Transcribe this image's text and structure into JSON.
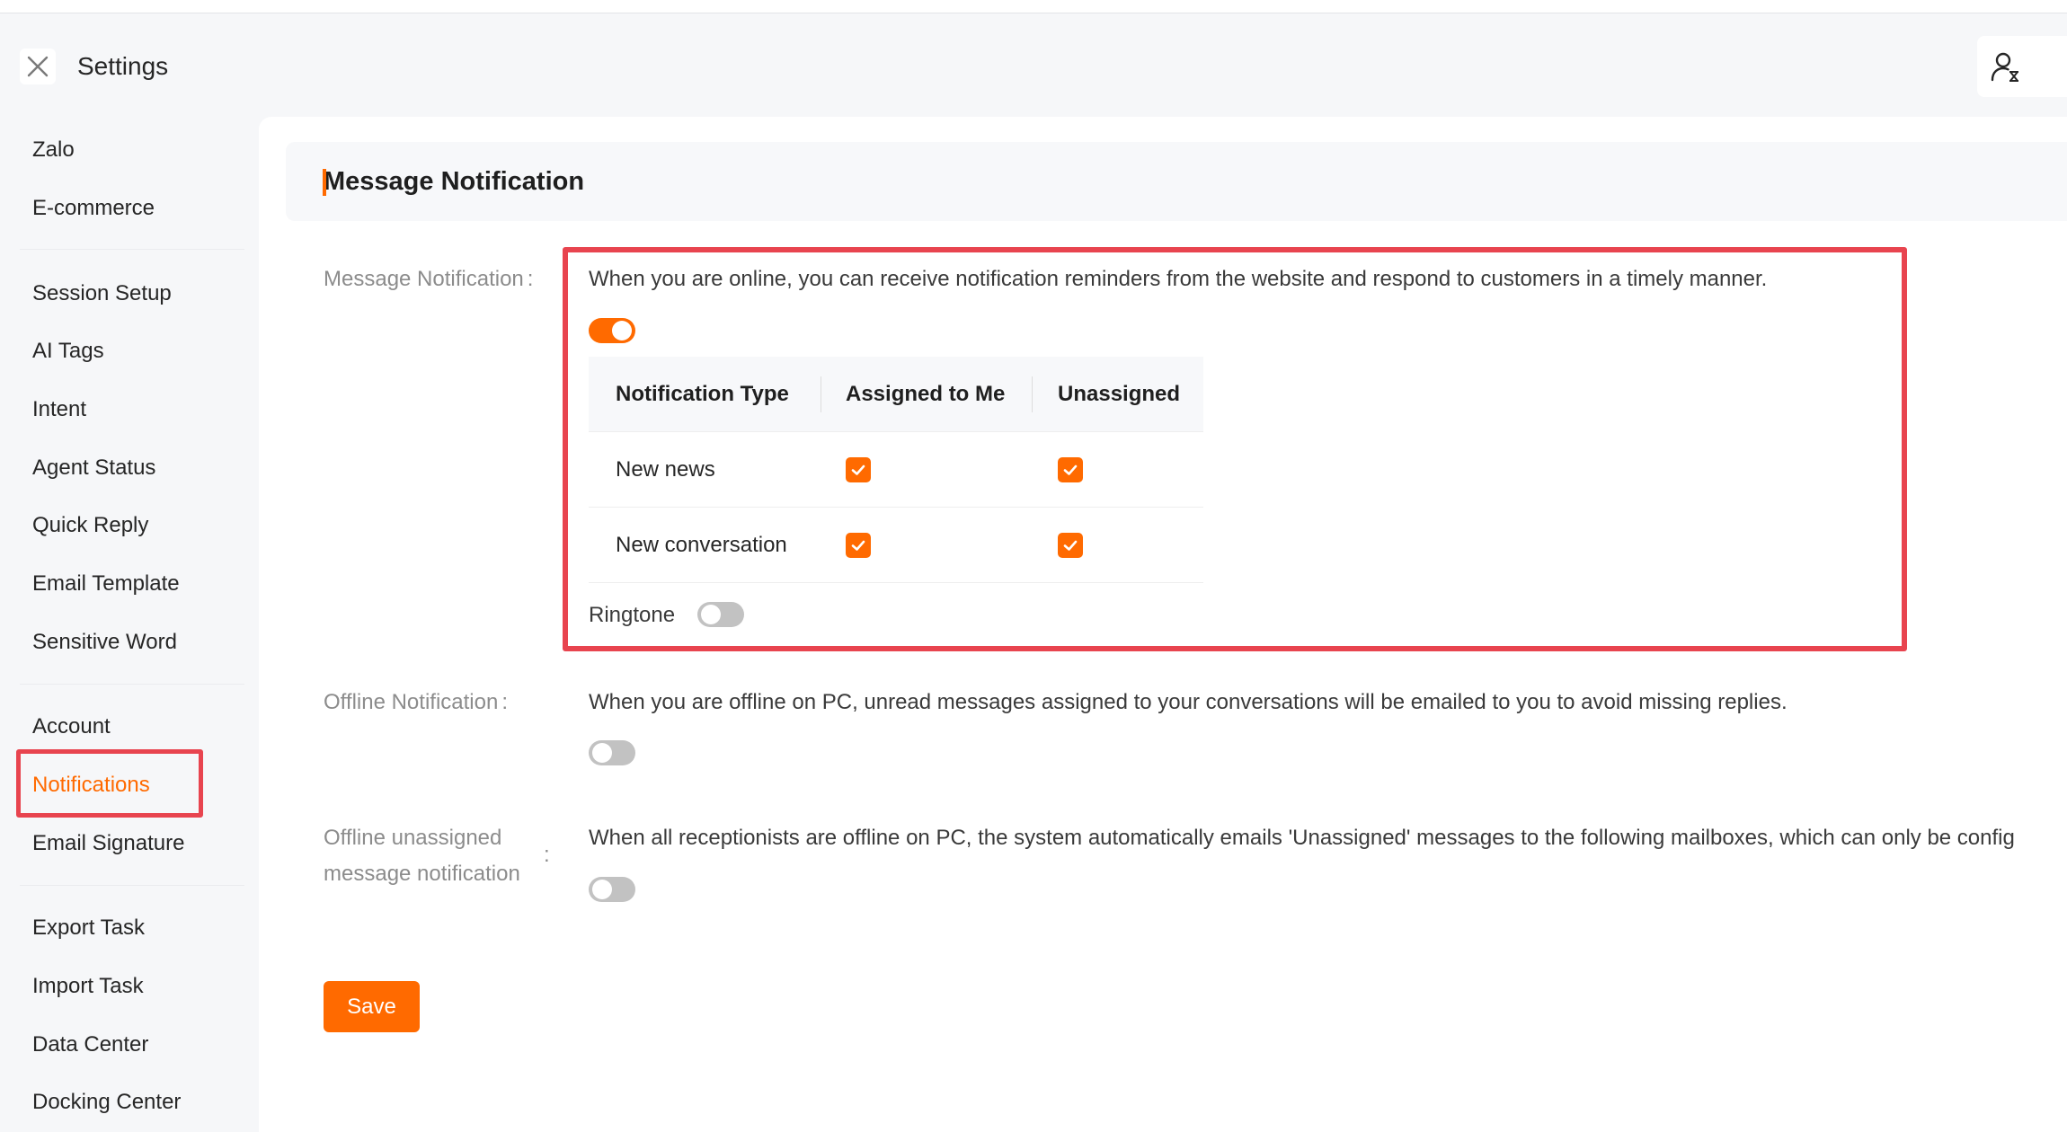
{
  "header": {
    "title": "Settings",
    "close_icon": "close-icon",
    "user_icon": "user-clock-icon"
  },
  "sidebar": {
    "groups": [
      [
        "Zalo",
        "E-commerce"
      ],
      [
        "Session Setup",
        "AI Tags",
        "Intent",
        "Agent Status",
        "Quick Reply",
        "Email Template",
        "Sensitive Word"
      ],
      [
        "Account",
        "Notifications",
        "Email Signature"
      ],
      [
        "Export Task",
        "Import Task",
        "Data Center",
        "Docking Center"
      ]
    ],
    "items": {
      "zalo": "Zalo",
      "ecommerce": "E-commerce",
      "session_setup": "Session Setup",
      "ai_tags": "AI Tags",
      "intent": "Intent",
      "agent_status": "Agent Status",
      "quick_reply": "Quick Reply",
      "email_template": "Email Template",
      "sensitive_word": "Sensitive Word",
      "account": "Account",
      "notifications": "Notifications",
      "email_signature": "Email Signature",
      "export_task": "Export Task",
      "import_task": "Import Task",
      "data_center": "Data Center",
      "docking_center": "Docking Center"
    },
    "active": "Notifications"
  },
  "section": {
    "title": "Message Notification"
  },
  "message_notification": {
    "label": "Message Notification",
    "colon": ":",
    "description": "When you are online, you can receive notification reminders from the website and respond to customers in a timely manner.",
    "enabled": true,
    "table": {
      "headers": [
        "Notification Type",
        "Assigned to Me",
        "Unassigned"
      ],
      "rows": [
        {
          "type": "New news",
          "assigned_to_me": true,
          "unassigned": true
        },
        {
          "type": "New conversation",
          "assigned_to_me": true,
          "unassigned": true
        }
      ]
    },
    "ringtone_label": "Ringtone",
    "ringtone_enabled": false
  },
  "offline_notification": {
    "label": "Offline Notification",
    "colon": ":",
    "description": "When you are offline on PC, unread messages assigned to your conversations will be emailed to you to avoid missing replies.",
    "enabled": false
  },
  "offline_unassigned": {
    "label_line1": "Offline unassigned",
    "label_line2": "message notification",
    "colon": ":",
    "description": "When all receptionists are offline on PC, the system automatically emails 'Unassigned' messages to the following mailboxes, which can only be config",
    "enabled": false
  },
  "actions": {
    "save_label": "Save"
  },
  "colors": {
    "accent": "#ff6a00",
    "highlight": "#e8444f"
  }
}
